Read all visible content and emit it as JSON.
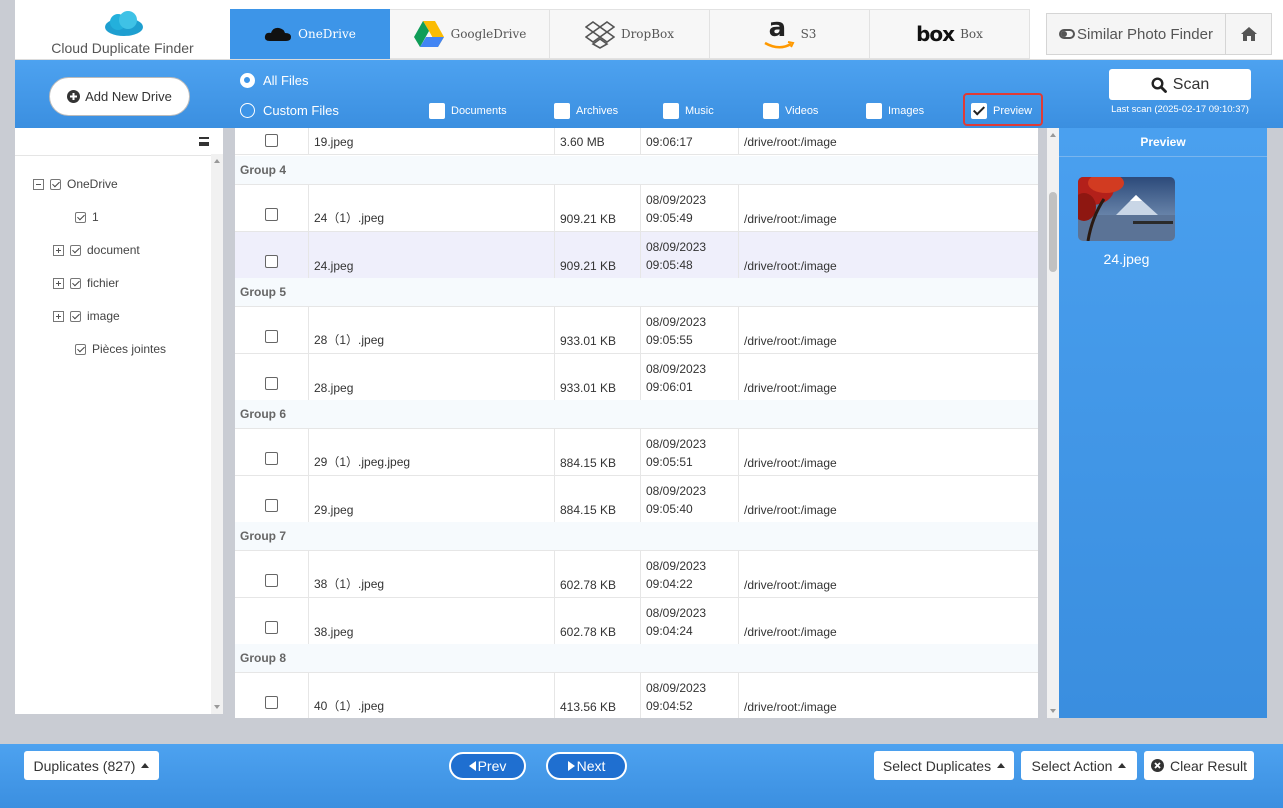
{
  "app": {
    "title": "Cloud Duplicate Finder"
  },
  "cloud_tabs": [
    {
      "label": "OneDrive",
      "icon": "onedrive-icon",
      "active": true
    },
    {
      "label": "GoogleDrive",
      "icon": "googledrive-icon",
      "active": false
    },
    {
      "label": "DropBox",
      "icon": "dropbox-icon",
      "active": false
    },
    {
      "label": "S3",
      "icon": "amazon-icon",
      "logo_text": "a",
      "active": false
    },
    {
      "label": "Box",
      "icon": "box-icon",
      "logo_text": "box",
      "active": false
    }
  ],
  "header": {
    "similar_label": "Similar Photo Finder",
    "home_icon": "home-icon"
  },
  "toolbar": {
    "add_drive_label": "Add New Drive",
    "all_files_label": "All Files",
    "custom_files_label": "Custom Files",
    "filters": [
      "Documents",
      "Archives",
      "Music",
      "Videos",
      "Images"
    ],
    "preview_label": "Preview",
    "scan_label": "Scan",
    "last_scan": "Last scan (2025-02-17 09:10:37)"
  },
  "tree": {
    "root": "OneDrive",
    "children": [
      "1",
      "document",
      "fichier",
      "image",
      "Pièces jointes"
    ]
  },
  "table": {
    "top_partial": {
      "name": "19.jpeg",
      "size": "3.60 MB",
      "time": "09:06:17",
      "path": "/drive/root:/image"
    },
    "groups": [
      {
        "label": "Group 4",
        "files": [
          {
            "name": "24（1）.jpeg",
            "size": "909.21 KB",
            "date": "08/09/2023",
            "time": "09:05:49",
            "path": "/drive/root:/image"
          },
          {
            "name": "24.jpeg",
            "size": "909.21 KB",
            "date": "08/09/2023",
            "time": "09:05:48",
            "path": "/drive/root:/image"
          }
        ]
      },
      {
        "label": "Group 5",
        "files": [
          {
            "name": "28（1）.jpeg",
            "size": "933.01 KB",
            "date": "08/09/2023",
            "time": "09:05:55",
            "path": "/drive/root:/image"
          },
          {
            "name": "28.jpeg",
            "size": "933.01 KB",
            "date": "08/09/2023",
            "time": "09:06:01",
            "path": "/drive/root:/image"
          }
        ]
      },
      {
        "label": "Group 6",
        "files": [
          {
            "name": "29（1）.jpeg.jpeg",
            "size": "884.15 KB",
            "date": "08/09/2023",
            "time": "09:05:51",
            "path": "/drive/root:/image"
          },
          {
            "name": "29.jpeg",
            "size": "884.15 KB",
            "date": "08/09/2023",
            "time": "09:05:40",
            "path": "/drive/root:/image"
          }
        ]
      },
      {
        "label": "Group 7",
        "files": [
          {
            "name": "38（1）.jpeg",
            "size": "602.78 KB",
            "date": "08/09/2023",
            "time": "09:04:22",
            "path": "/drive/root:/image"
          },
          {
            "name": "38.jpeg",
            "size": "602.78 KB",
            "date": "08/09/2023",
            "time": "09:04:24",
            "path": "/drive/root:/image"
          }
        ]
      },
      {
        "label": "Group 8",
        "files": [
          {
            "name": "40（1）.jpeg",
            "size": "413.56 KB",
            "date": "08/09/2023",
            "time": "09:04:52",
            "path": "/drive/root:/image"
          }
        ]
      }
    ]
  },
  "preview": {
    "title": "Preview",
    "file_name": "24.jpeg"
  },
  "footer": {
    "duplicates_label": "Duplicates (827)",
    "prev_label": "Prev",
    "next_label": "Next",
    "select_duplicates_label": "Select Duplicates",
    "select_action_label": "Select Action",
    "clear_result_label": "Clear Result"
  },
  "colors": {
    "accent": "#3d95e8",
    "highlight_border": "#e03b36",
    "selected_row": "#efeffb"
  }
}
